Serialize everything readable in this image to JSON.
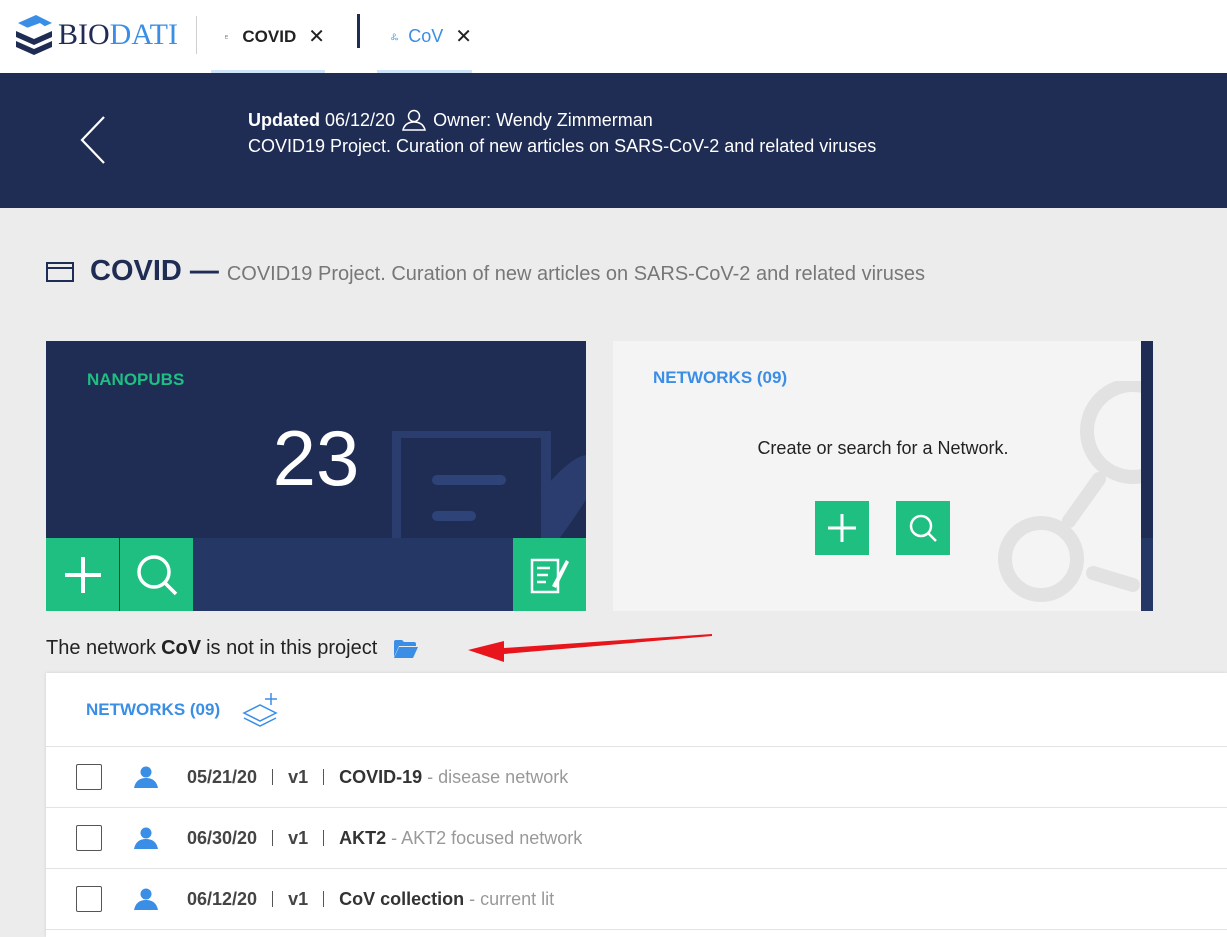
{
  "app": {
    "logo_text_1": "BIO",
    "logo_text_2": "DATI",
    "brand_colors": {
      "navy": "#1f2d55",
      "blue": "#3a8ee6",
      "green": "#1fbf82"
    }
  },
  "tabs": [
    {
      "label": "COVID",
      "icon": "project-window-icon",
      "close": "✕"
    },
    {
      "label": "CoV",
      "icon": "network-nodes-icon",
      "close": "✕"
    }
  ],
  "header": {
    "updated_label": "Updated",
    "updated_date": "06/12/20",
    "owner": "Owner: Wendy Zimmerman",
    "description": "COVID19 Project. Curation of new articles on SARS-CoV-2 and related viruses"
  },
  "page": {
    "title": "COVID",
    "dash": "—",
    "subtitle": "COVID19 Project. Curation of new articles on SARS-CoV-2 and related viruses"
  },
  "nanopubs": {
    "label": "NANOPUBS",
    "count": "23"
  },
  "networks_card": {
    "label": "NETWORKS (09)",
    "message": "Create or search for a Network."
  },
  "notice": {
    "prefix": "The network",
    "network": "CoV",
    "suffix": "is not in this project"
  },
  "networks_panel": {
    "title": "NETWORKS (09)",
    "rows": [
      {
        "date": "05/21/20",
        "version": "v1",
        "name": "COVID-19",
        "desc": "- disease network"
      },
      {
        "date": "06/30/20",
        "version": "v1",
        "name": "AKT2",
        "desc": "- AKT2 focused network"
      },
      {
        "date": "06/12/20",
        "version": "v1",
        "name": "CoV collection",
        "desc": "- current lit"
      }
    ]
  }
}
